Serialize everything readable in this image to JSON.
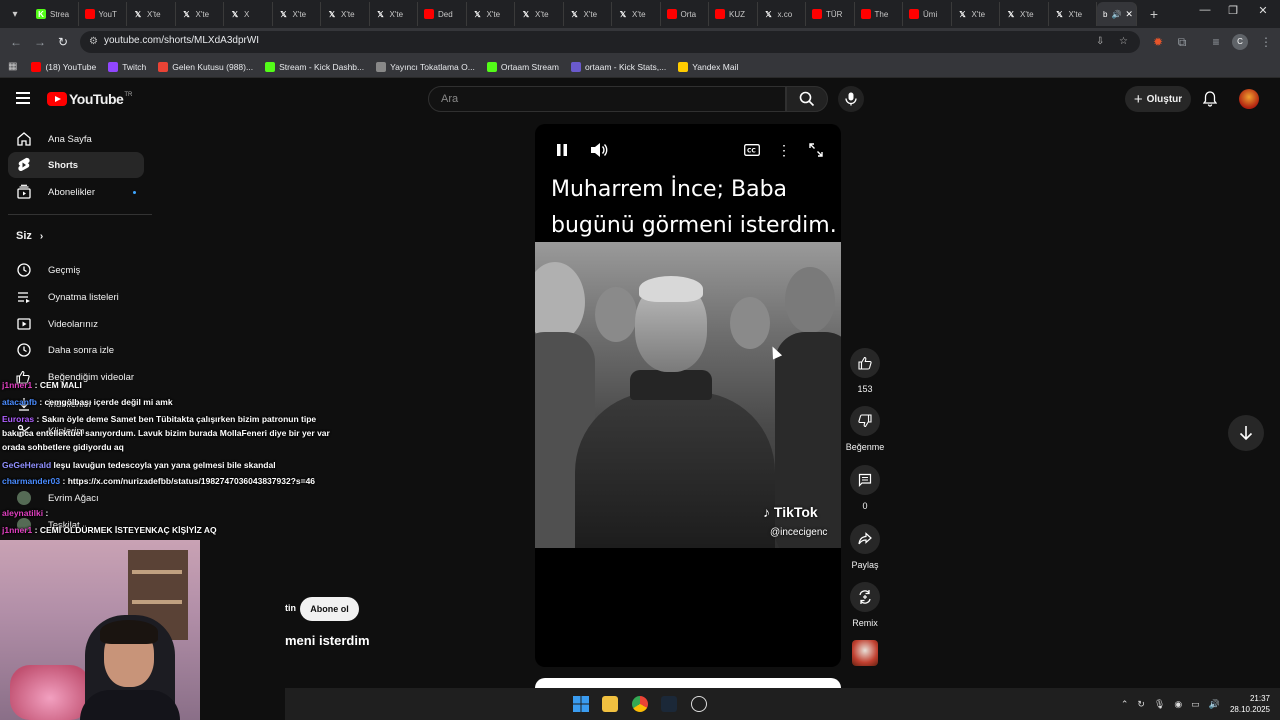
{
  "browser": {
    "tabs": [
      {
        "label": "Strea",
        "icon": "kick-icon",
        "color": "#53fc18"
      },
      {
        "label": "YouT",
        "icon": "youtube-icon",
        "color": "#ff0000"
      },
      {
        "label": "X'te",
        "icon": "x-icon",
        "color": "#000000"
      },
      {
        "label": "X'te",
        "icon": "x-icon",
        "color": "#000000"
      },
      {
        "label": "X",
        "icon": "x-icon",
        "color": "#000000"
      },
      {
        "label": "X'te",
        "icon": "x-icon",
        "color": "#000000"
      },
      {
        "label": "X'te",
        "icon": "x-icon",
        "color": "#000000"
      },
      {
        "label": "X'te",
        "icon": "x-icon",
        "color": "#000000"
      },
      {
        "label": "Ded",
        "icon": "youtube-icon",
        "color": "#ff0000"
      },
      {
        "label": "X'te",
        "icon": "x-icon",
        "color": "#000000"
      },
      {
        "label": "X'te",
        "icon": "x-icon",
        "color": "#000000"
      },
      {
        "label": "X'te",
        "icon": "x-icon",
        "color": "#000000"
      },
      {
        "label": "X'te",
        "icon": "x-icon",
        "color": "#000000"
      },
      {
        "label": "Orta",
        "icon": "youtube-icon",
        "color": "#ff0000"
      },
      {
        "label": "KUZ",
        "icon": "youtube-icon",
        "color": "#ff0000"
      },
      {
        "label": "x.co",
        "icon": "x-icon",
        "color": "#000000"
      },
      {
        "label": "TÜR",
        "icon": "youtube-icon",
        "color": "#ff0000"
      },
      {
        "label": "The",
        "icon": "youtube-icon",
        "color": "#ff0000"
      },
      {
        "label": "Ümi",
        "icon": "youtube-icon",
        "color": "#ff0000"
      },
      {
        "label": "X'te",
        "icon": "x-icon",
        "color": "#000000"
      },
      {
        "label": "X'te",
        "icon": "x-icon",
        "color": "#000000"
      },
      {
        "label": "X'te",
        "icon": "x-icon",
        "color": "#000000"
      }
    ],
    "active_tab_label": "b",
    "url": "youtube.com/shorts/MLXdA3dprWI",
    "bookmarks": [
      {
        "label": "(18) YouTube",
        "icon": "youtube-icon",
        "color": "#ff0000"
      },
      {
        "label": "Twitch",
        "icon": "twitch-icon",
        "color": "#9146ff"
      },
      {
        "label": "Gelen Kutusu (988)...",
        "icon": "gmail-icon",
        "color": "#ea4335"
      },
      {
        "label": "Stream - Kick Dashb...",
        "icon": "kick-icon",
        "color": "#53fc18"
      },
      {
        "label": "Yayıncı Tokatlama O...",
        "icon": "globe-icon",
        "color": "#888888"
      },
      {
        "label": "Ortaam Stream",
        "icon": "kick-icon",
        "color": "#53fc18"
      },
      {
        "label": "ortaam - Kick Stats,...",
        "icon": "stats-icon",
        "color": "#6a5acd"
      },
      {
        "label": "Yandex Mail",
        "icon": "mail-icon",
        "color": "#ffcc00"
      }
    ]
  },
  "header": {
    "logo_text": "YouTube",
    "logo_region": "TR",
    "search_placeholder": "Ara",
    "create_label": "Oluştur"
  },
  "sidebar": {
    "items": [
      {
        "label": "Ana Sayfa",
        "icon": "home-icon"
      },
      {
        "label": "Shorts",
        "icon": "shorts-icon"
      },
      {
        "label": "Abonelikler",
        "icon": "subscriptions-icon"
      }
    ],
    "you_section_title": "Siz",
    "you_items": [
      {
        "label": "Geçmiş",
        "icon": "history-icon"
      },
      {
        "label": "Oynatma listeleri",
        "icon": "playlists-icon"
      },
      {
        "label": "Videolarınız",
        "icon": "your-videos-icon"
      },
      {
        "label": "Daha sonra izle",
        "icon": "watch-later-icon"
      },
      {
        "label": "Beğendiğim videolar",
        "icon": "liked-icon"
      },
      {
        "label": "İndirilenler",
        "icon": "download-icon"
      },
      {
        "label": "Kliplerim",
        "icon": "clips-icon"
      }
    ],
    "subscriptions": [
      {
        "label": "Evrim Ağacı"
      },
      {
        "label": "Teşkilat"
      }
    ]
  },
  "chat": [
    {
      "user": "j1nner1",
      "text": ": CEM MALI",
      "user_color": "#e040c0"
    },
    {
      "user": "atacanfb",
      "text": ": cemgölbaşı içerde değil mi amk",
      "user_color": "#4a8cff"
    },
    {
      "user": "Euroras",
      "text": ": Sakın öyle deme Samet ben Tübitakta çalışırken bizim patronun tipe bakınca entellektüel sanıyordum. Lavuk bizim burada MollaFeneri diye bir yer var orada sohbetlere gidiyordu aq",
      "user_color": "#b060ff"
    },
    {
      "user": "GeGeHerald",
      "text": "leşu lavuğun tedescoyla yan yana gelmesi bile skandal",
      "user_color": "#9090ff"
    },
    {
      "user": "charmander03",
      "text": ": https://x.com/nurizadefbb/status/1982747036043837932?s=46",
      "user_color": "#4a8cff"
    },
    {
      "user": "aleynatilki",
      "text": ":",
      "user_color": "#e040c0"
    },
    {
      "user": "j1nner1",
      "text": ": CEMİ ÖLDÜRMEK İSTEYENKAÇ KİŞİYİZ AQ",
      "user_color": "#e040c0"
    }
  ],
  "short": {
    "caption": "Muharrem İnce; Baba bugünü görmeni isterdim.",
    "watermark": "TikTok",
    "handle": "@incecigenc",
    "subscribe_label": "Abone ol",
    "channel_suffix": "tin",
    "title_below": "meni isterdim"
  },
  "actions": {
    "like_count": "153",
    "dislike_label": "Beğenme",
    "comments_count": "0",
    "share_label": "Paylaş",
    "remix_label": "Remix"
  },
  "taskbar": {
    "time": "21:37",
    "date": "28.10.2025"
  }
}
